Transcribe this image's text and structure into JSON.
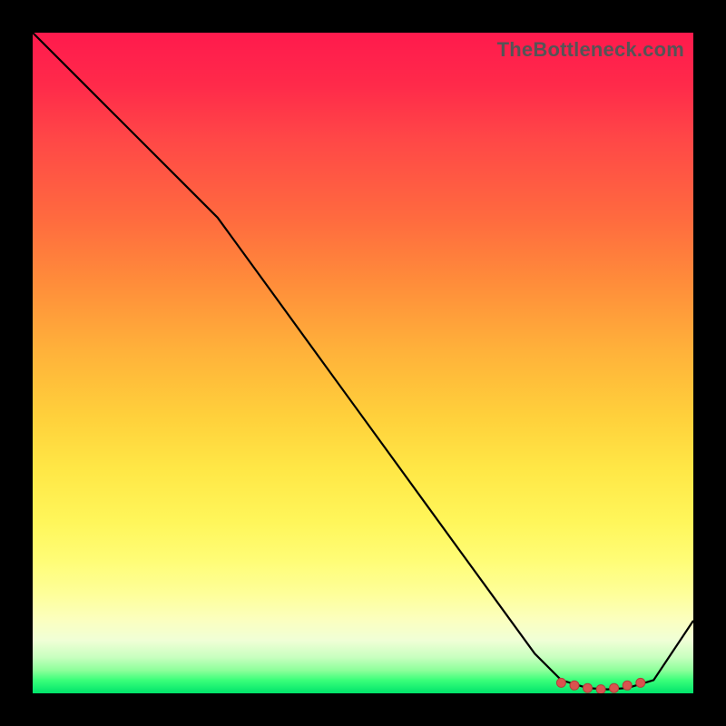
{
  "watermark": "TheBottleneck.com",
  "chart_data": {
    "type": "line",
    "title": "",
    "xlabel": "",
    "ylabel": "",
    "xlim": [
      0,
      100
    ],
    "ylim": [
      0,
      100
    ],
    "grid": false,
    "legend": false,
    "background": "heatmap-gradient",
    "series": [
      {
        "name": "bottleneck-curve",
        "color": "#000000",
        "x": [
          0,
          8,
          16,
          24,
          28,
          36,
          44,
          52,
          60,
          68,
          76,
          80,
          84,
          87,
          90,
          94,
          100
        ],
        "values": [
          100,
          92,
          84,
          76,
          72,
          61,
          50,
          39,
          28,
          17,
          6,
          2,
          0.8,
          0.6,
          0.8,
          2,
          11
        ]
      }
    ],
    "markers": {
      "name": "optimal-range",
      "color": "#d9534f",
      "x": [
        80,
        82,
        84,
        86,
        88,
        90,
        92
      ],
      "values": [
        1.6,
        1.2,
        0.8,
        0.6,
        0.8,
        1.2,
        1.6
      ]
    }
  }
}
